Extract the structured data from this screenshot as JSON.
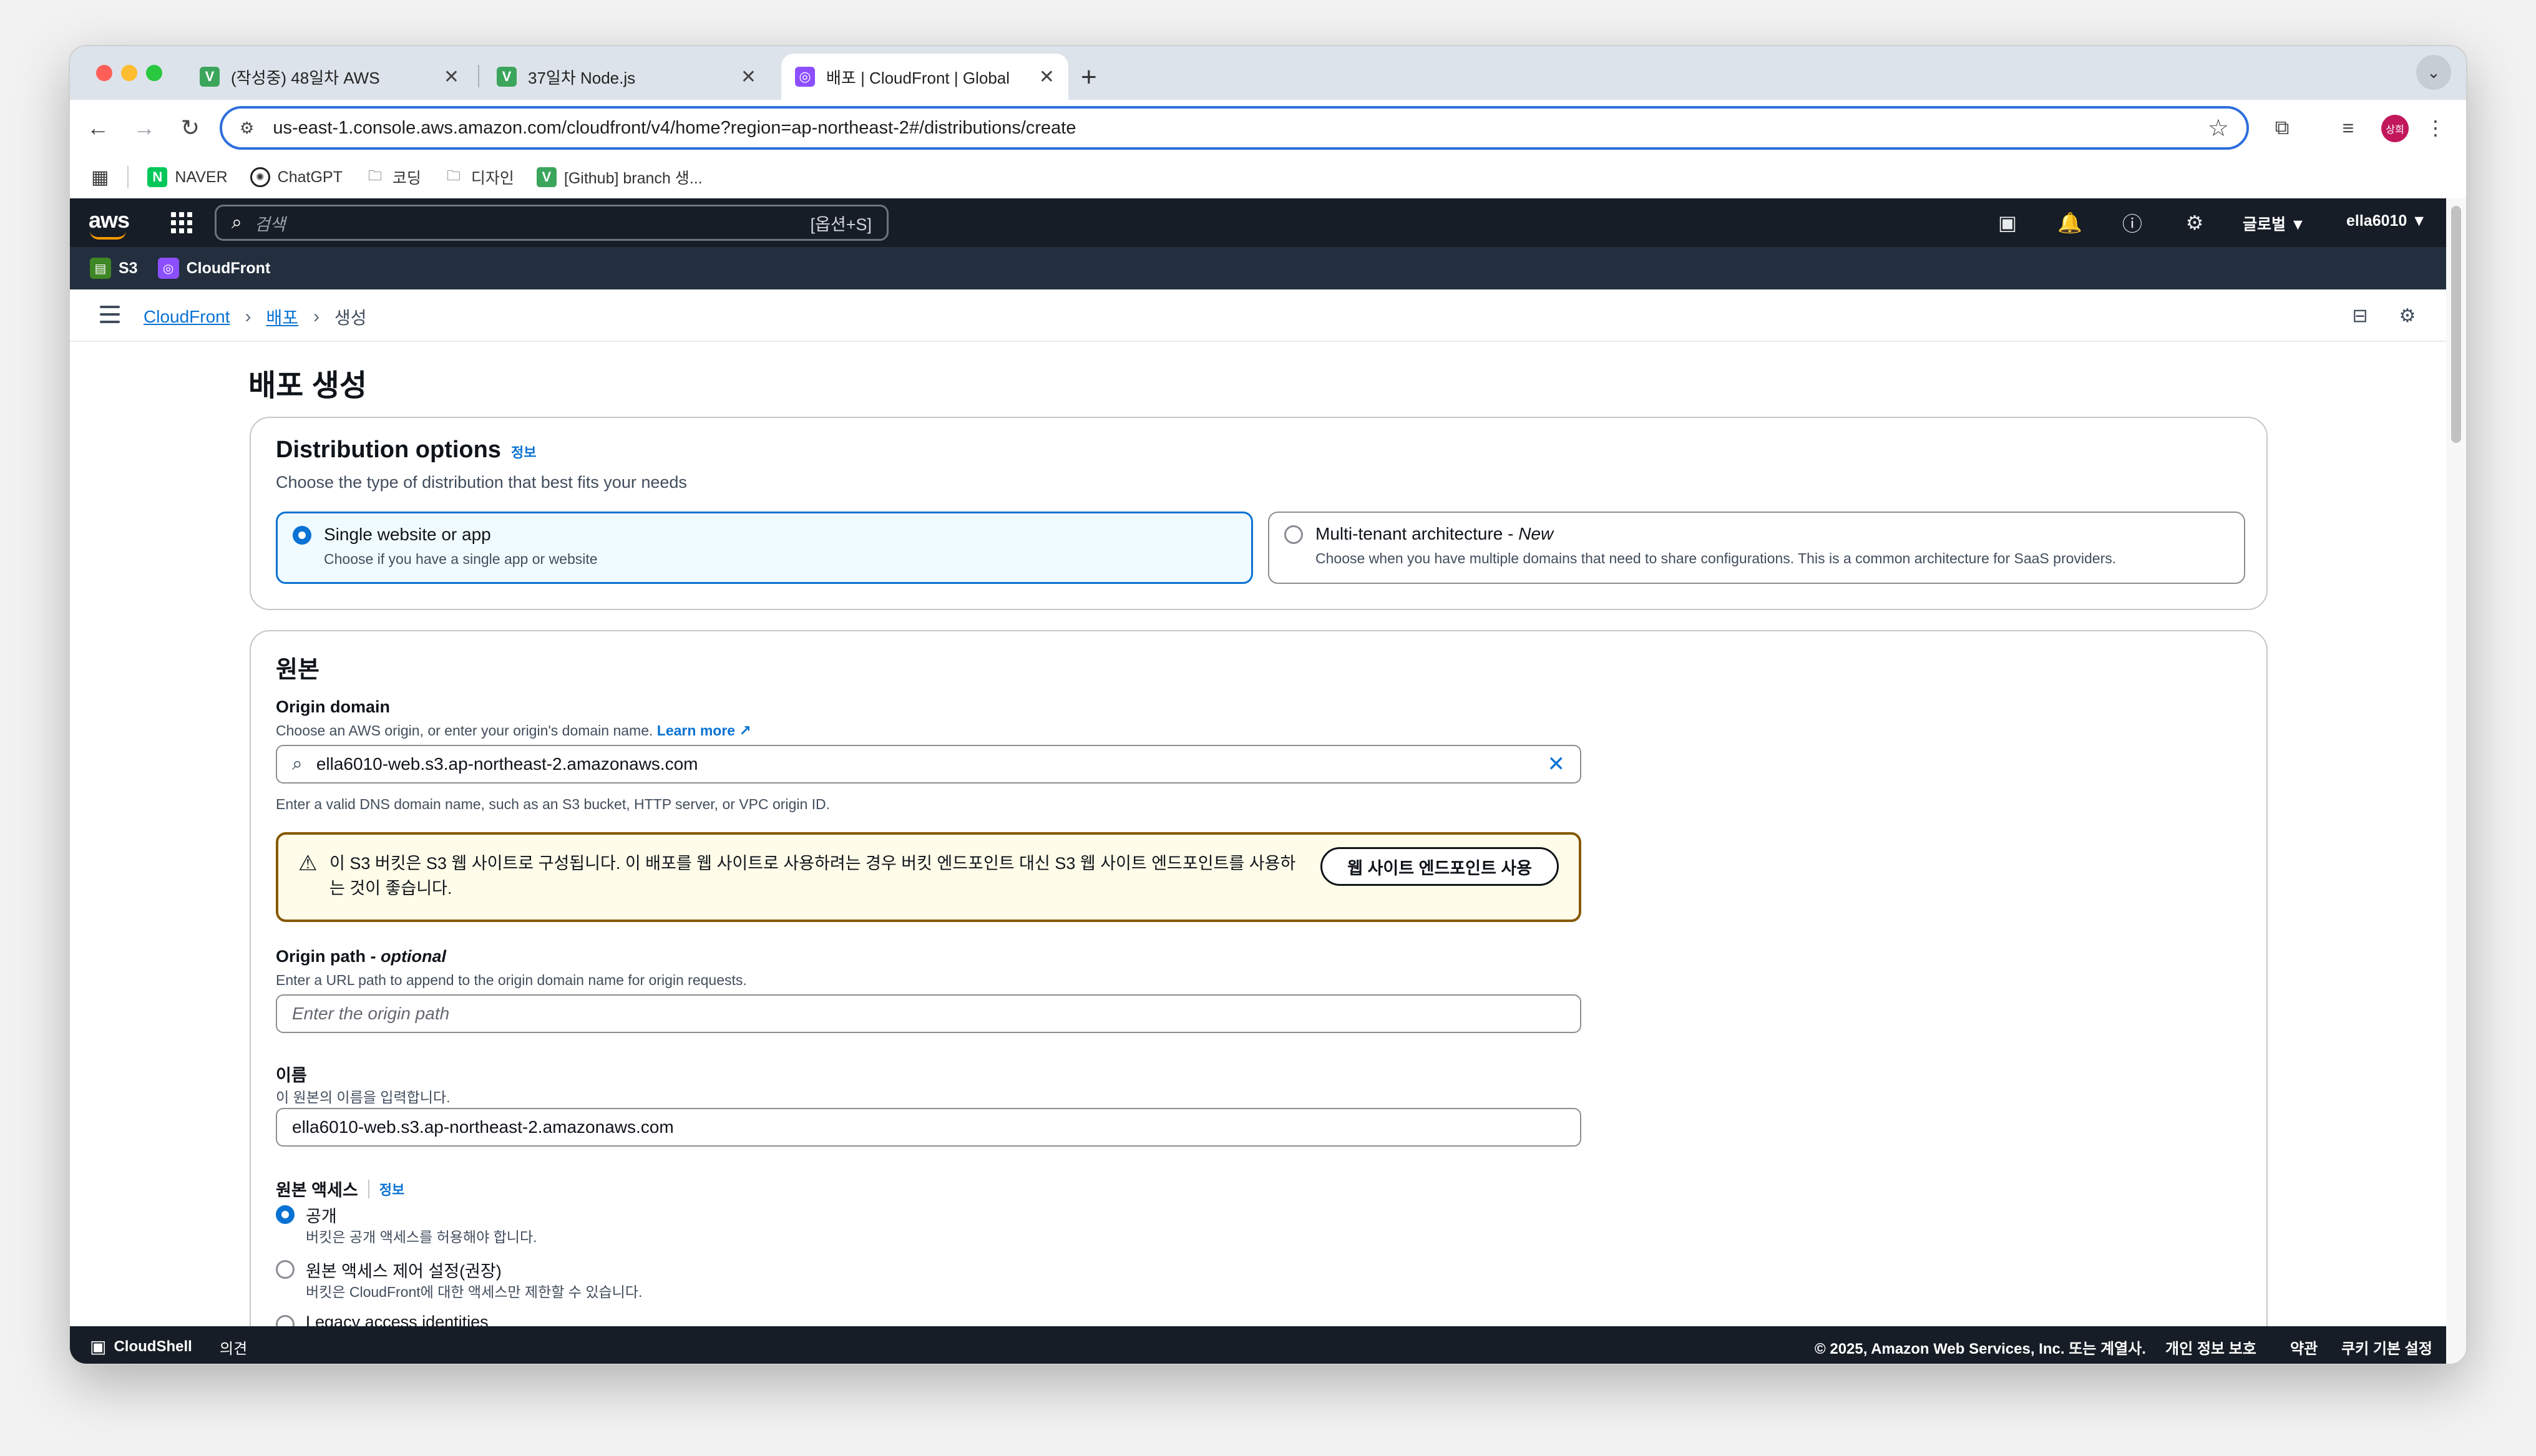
{
  "browser": {
    "tabs": [
      {
        "title": "(작성중) 48일차 AWS",
        "favicon_color": "#3ca55c",
        "favicon_glyph": "V"
      },
      {
        "title": "37일차 Node.js",
        "favicon_color": "#3ca55c",
        "favicon_glyph": "V"
      },
      {
        "title": "배포 | CloudFront | Global",
        "favicon_color": "#8c4fff",
        "favicon_glyph": "◎"
      }
    ],
    "new_tab_label": "+",
    "url": "us-east-1.console.aws.amazon.com/cloudfront/v4/home?region=ap-northeast-2#/distributions/create",
    "profile_initial": "상희"
  },
  "bookmarks": [
    {
      "label": "NAVER",
      "icon": "naver-icon"
    },
    {
      "label": "ChatGPT",
      "icon": "chatgpt-icon"
    },
    {
      "label": "코딩",
      "icon": "folder-icon"
    },
    {
      "label": "디자인",
      "icon": "folder-icon"
    },
    {
      "label": "[Github] branch 생...",
      "icon": "velog-icon"
    }
  ],
  "aws_nav": {
    "logo": "aws",
    "search_placeholder": "검색",
    "search_shortcut": "[옵션+S]",
    "region": "글로벌 ▼",
    "account": "ella6010 ▼"
  },
  "services": [
    {
      "label": "S3",
      "color": "#3f8624"
    },
    {
      "label": "CloudFront",
      "color": "#8c4fff"
    }
  ],
  "breadcrumb": {
    "items": [
      "CloudFront",
      "배포"
    ],
    "current": "생성"
  },
  "page": {
    "title": "배포 생성"
  },
  "distribution_options": {
    "heading": "Distribution options",
    "info": "정보",
    "description": "Choose the type of distribution that best fits your needs",
    "options": [
      {
        "title": "Single website or app",
        "desc": "Choose if you have a single app or website",
        "selected": true
      },
      {
        "title": "Multi-tenant architecture - ",
        "title_suffix": "New",
        "desc": "Choose when you have multiple domains that need to share configurations. This is a common architecture for SaaS providers.",
        "selected": false
      }
    ]
  },
  "origin": {
    "heading": "원본",
    "domain_label": "Origin domain",
    "domain_hint": "Choose an AWS origin, or enter your origin's domain name.",
    "learn_more": "Learn more",
    "domain_value": "ella6010-web.s3.ap-northeast-2.amazonaws.com",
    "domain_help": "Enter a valid DNS domain name, such as an S3 bucket, HTTP server, or VPC origin ID.",
    "warning_text": "이 S3 버킷은 S3 웹 사이트로 구성됩니다. 이 배포를 웹 사이트로 사용하려는 경우 버킷 엔드포인트 대신 S3 웹 사이트 엔드포인트를 사용하는 것이 좋습니다.",
    "warning_button": "웹 사이트 엔드포인트 사용",
    "path_label": "Origin path - ",
    "path_label_suffix": "optional",
    "path_hint": "Enter a URL path to append to the origin domain name for origin requests.",
    "path_placeholder": "Enter the origin path",
    "name_label": "이름",
    "name_hint": "이 원본의 이름을 입력합니다.",
    "name_value": "ella6010-web.s3.ap-northeast-2.amazonaws.com",
    "access_label": "원본 액세스",
    "access_info": "정보",
    "access_options": [
      {
        "title": "공개",
        "desc": "버킷은 공개 액세스를 허용해야 합니다.",
        "selected": true
      },
      {
        "title": "원본 액세스 제어 설정(권장)",
        "desc": "버킷은 CloudFront에 대한 액세스만 제한할 수 있습니다.",
        "selected": false
      },
      {
        "title": "Legacy access identities",
        "desc": "",
        "selected": false
      }
    ]
  },
  "footer": {
    "cloudshell": "CloudShell",
    "feedback": "의견",
    "copyright": "© 2025, Amazon Web Services, Inc. 또는 계열사.",
    "privacy": "개인 정보 보호",
    "terms": "약관",
    "cookies": "쿠키 기본 설정"
  }
}
